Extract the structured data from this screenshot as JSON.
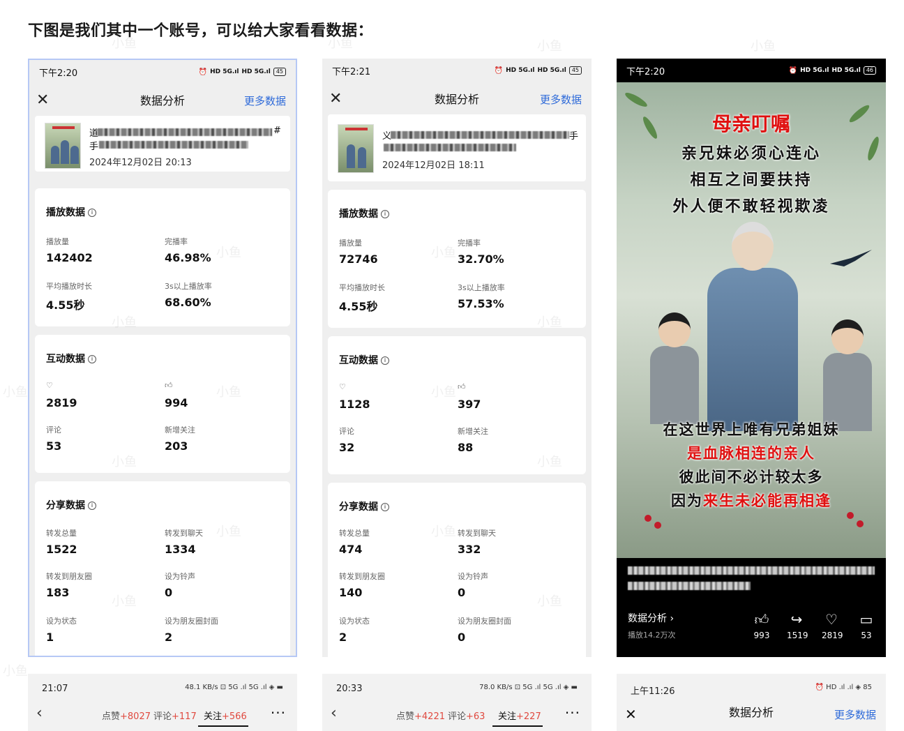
{
  "heading": "下图是我们其中一个账号，可以给大家看看数据：",
  "labels": {
    "page_title": "数据分析",
    "more": "更多数据",
    "play_section": "播放数据",
    "play_count": "播放量",
    "completion": "完播率",
    "avg_duration": "平均播放时长",
    "over3s": "3s以上播放率",
    "interact_section": "互动数据",
    "comments": "评论",
    "new_follow": "新增关注",
    "share_section": "分享数据",
    "share_total": "转发总量",
    "share_chat": "转发到聊天",
    "share_moments": "转发到朋友圈",
    "ringtone": "设为铃声",
    "status": "设为状态",
    "moments_cover": "设为朋友圈封面"
  },
  "phone1": {
    "time": "下午2:20",
    "battery": "45",
    "date": "2024年12月02日 20:13",
    "title_tail": "#",
    "title_line2": "手",
    "title_head": "道",
    "play": "142402",
    "completion": "46.98%",
    "avg": "4.55秒",
    "over3s": "68.60%",
    "likes": "2819",
    "thumbs": "994",
    "comments": "53",
    "follows": "203",
    "share_total": "1522",
    "share_chat": "1334",
    "share_moments": "183",
    "ringtone": "0",
    "status": "1",
    "cover": "2"
  },
  "phone2": {
    "time": "下午2:21",
    "battery": "45",
    "date": "2024年12月02日 18:11",
    "title_tail": "手",
    "title_head": "义",
    "play": "72746",
    "completion": "32.70%",
    "avg": "4.55秒",
    "over3s": "57.53%",
    "likes": "1128",
    "thumbs": "397",
    "comments": "32",
    "follows": "88",
    "share_total": "474",
    "share_chat": "332",
    "share_moments": "140",
    "ringtone": "0",
    "status": "2",
    "cover": "0"
  },
  "phone3": {
    "time": "下午2:20",
    "battery": "46",
    "poster_lines": {
      "l1": "母亲叮嘱",
      "l2": "亲兄妹必须心连心",
      "l3": "相互之间要扶持",
      "l4": "外人便不敢轻视欺凌",
      "l5": "在这世界上唯有兄弟姐妹",
      "l6": "是血脉相连的亲人",
      "l7": "彼此间不必计较太多",
      "l8a": "因为",
      "l8b": "来生未必能再相逢"
    },
    "analysis_link": "数据分析 ›",
    "plays": "播放14.2万次",
    "thumbs": "993",
    "shares": "1519",
    "likes": "2819",
    "comments": "53"
  },
  "strip1": {
    "time": "21:07",
    "icons": "48.1 KB/s ⊡ 5G .ıl 5G .ıl ◈ ▬",
    "likes_label": "点赞",
    "likes_plus": "+8027",
    "comments_label": "评论",
    "comments_plus": "+117",
    "follow_label": "关注",
    "follow_plus": "+566",
    "more": "···"
  },
  "strip2": {
    "time": "20:33",
    "icons": "78.0 KB/s ⊡ 5G .ıl 5G .ıl ◈ ▬",
    "likes_label": "点赞",
    "likes_plus": "+4221",
    "comments_label": "评论",
    "comments_plus": "+63",
    "follow_label": "关注",
    "follow_plus": "+227",
    "more": "···"
  },
  "strip3": {
    "time": "上午11:26",
    "icons": "⏰ HD .ıl .ıl ◈ 85",
    "title": "数据分析",
    "more": "更多数据"
  },
  "watermark": "小鱼",
  "colors": {
    "link": "#2f6bd9",
    "accent_red": "#e0493f",
    "phone1_border": "#b6c8f5"
  }
}
